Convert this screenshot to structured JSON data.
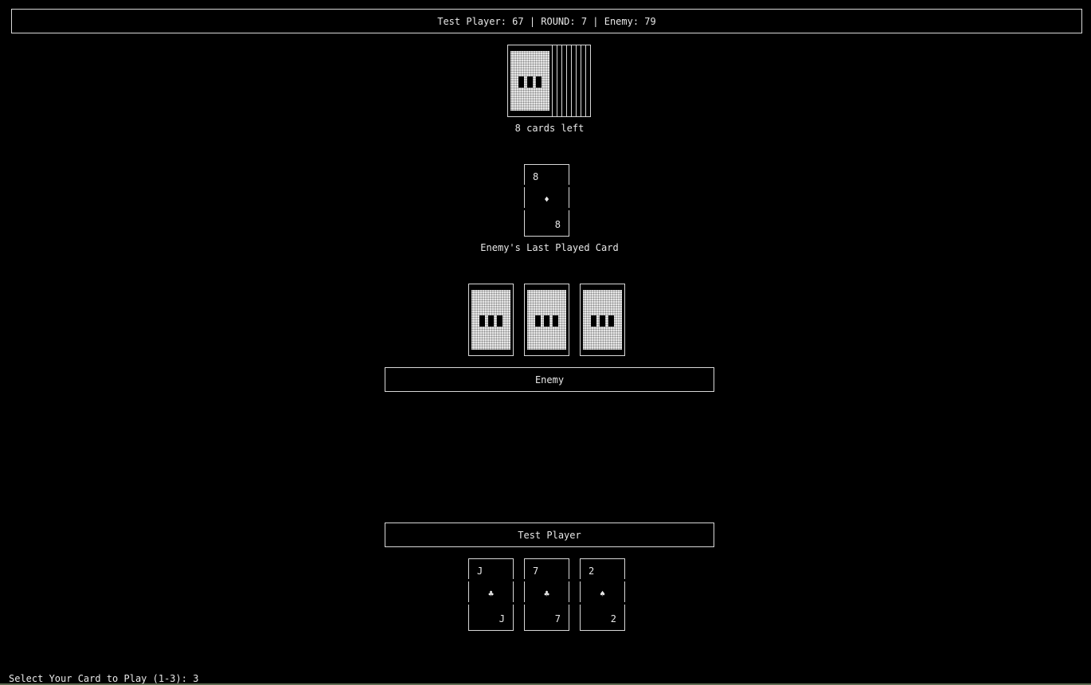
{
  "scoreboard": {
    "text": "Test Player: 67 | ROUND: 7 | Enemy: 79"
  },
  "deck": {
    "cards_left_label": "8 cards left"
  },
  "last_played": {
    "rank": "8",
    "suit": "♦",
    "label": "Enemy's Last Played Card"
  },
  "enemy": {
    "name": "Enemy",
    "hand_count": 3
  },
  "player": {
    "name": "Test Player",
    "hand": [
      {
        "rank": "J",
        "suit": "♣"
      },
      {
        "rank": "7",
        "suit": "♣"
      },
      {
        "rank": "2",
        "suit": "♠"
      }
    ]
  },
  "prompt": {
    "text": "Select Your Card to Play (1-3): 3"
  }
}
